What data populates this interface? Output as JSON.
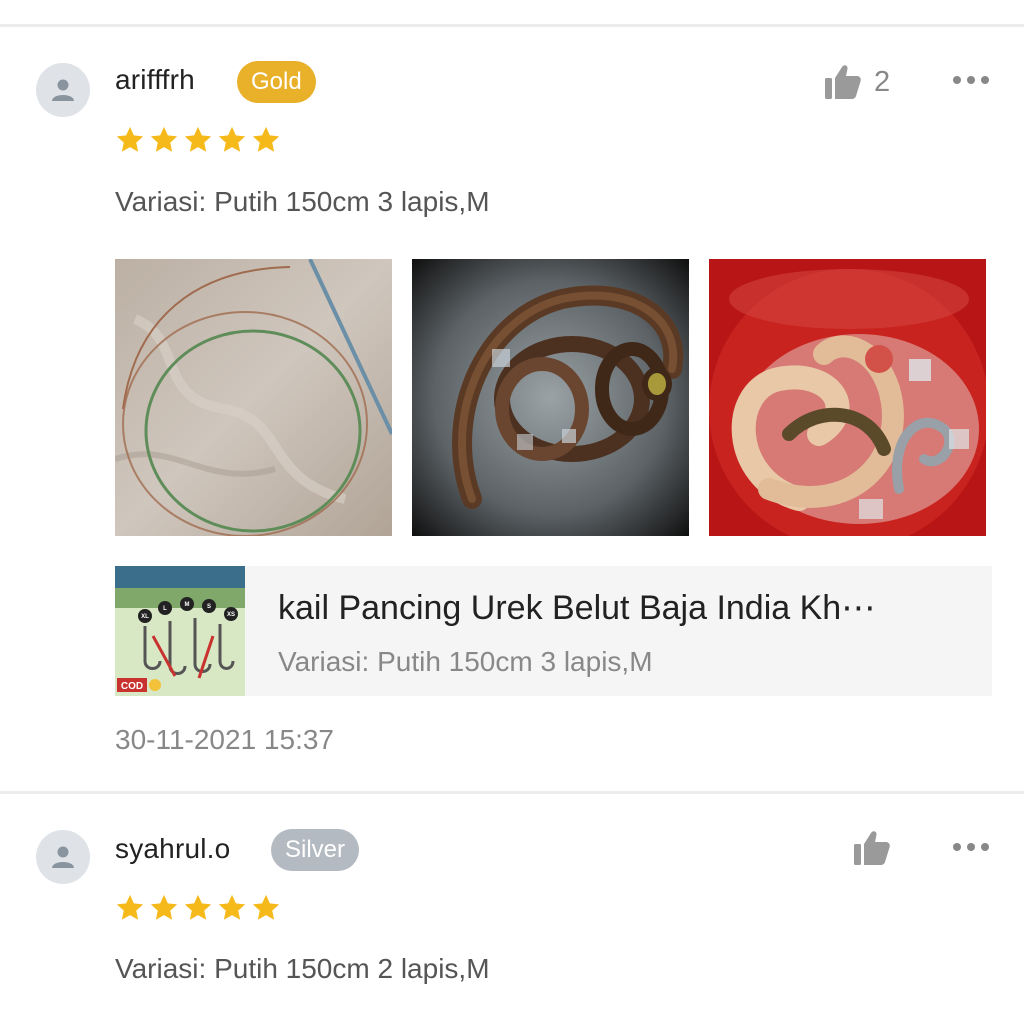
{
  "reviews": [
    {
      "username": "arifffrh",
      "tier": "Gold",
      "rating": 5,
      "likes": "2",
      "variation": "Variasi: Putih 150cm 3 lapis,M",
      "photos": [
        {
          "icon": "fishing-line-coil-photo"
        },
        {
          "icon": "eels-in-sink-photo"
        },
        {
          "icon": "eels-in-red-bucket-photo"
        }
      ],
      "product": {
        "name": "kail Pancing Urek Belut Baja India Kh⋯",
        "variation": "Variasi: Putih 150cm 3 lapis,M",
        "thumb_text_cod": "COD",
        "thumb_sizes": [
          "XL",
          "L",
          "M",
          "S",
          "XS"
        ]
      },
      "timestamp": "30-11-2021 15:37"
    },
    {
      "username": "syahrul.o",
      "tier": "Silver",
      "rating": 5,
      "likes": "",
      "variation": "Variasi: Putih 150cm 2 lapis,M"
    }
  ],
  "colors": {
    "gold": "#e9b12a",
    "silver": "#b4bac1",
    "star": "#f5b91a"
  },
  "icons": {
    "avatar": "user-icon",
    "like": "thumbs-up-icon",
    "more": "more-dots-icon",
    "star": "star-icon"
  }
}
